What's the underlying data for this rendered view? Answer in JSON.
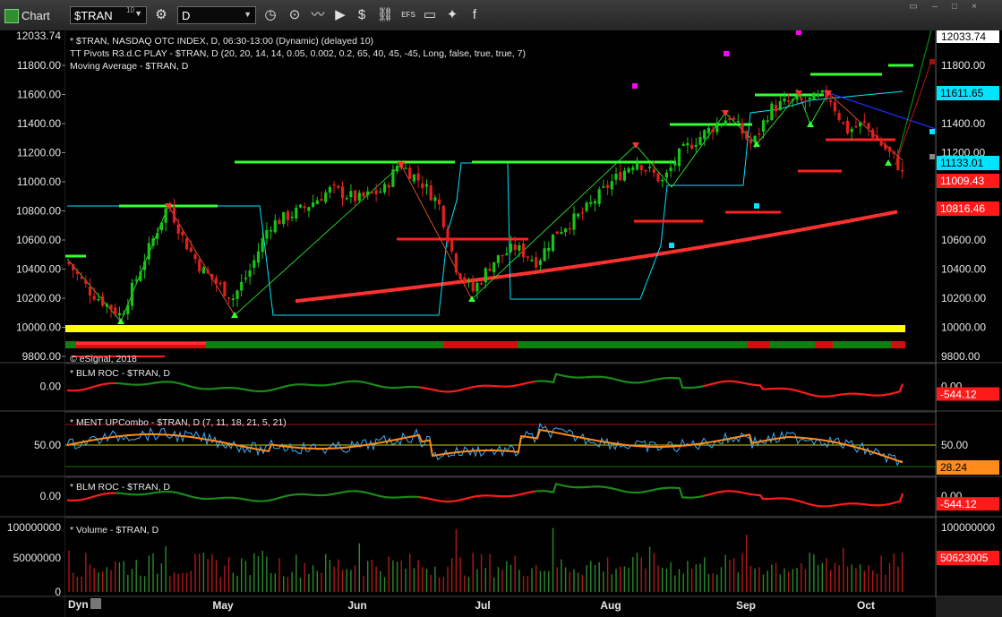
{
  "window": {
    "title": "Chart",
    "symbol": "$TRAN",
    "symbol_sup": "10",
    "interval": "D"
  },
  "toolbar_icons": [
    "settings-icon",
    "interval-clock-icon",
    "zoom-icon",
    "line-tool-icon",
    "play-icon",
    "dollar-icon",
    "link-icon",
    "efs-icon",
    "comment-icon",
    "twitter-icon",
    "facebook-icon"
  ],
  "price_panel": {
    "titles": [
      "* $TRAN, NASDAQ OTC INDEX, D, 06:30-13:00 (Dynamic) (delayed 10)",
      "TT Pivots R3.d.C PLAY - $TRAN, D (20, 20, 14, 14, 0.05, 0.002, 0.2, 65, 40, 45, -45, Long, false, true, true, 7)",
      "Moving Average - $TRAN, D"
    ],
    "watermark": "© eSignal, 2018",
    "y_ticks": [
      "11800.00",
      "11600.00",
      "11400.00",
      "11200.00",
      "11000.00",
      "10800.00",
      "10600.00",
      "10400.00",
      "10200.00",
      "10000.00",
      "9800.00"
    ],
    "top_value": "12033.74",
    "tags": [
      {
        "value": "11611.65",
        "bg": "#00e5ff",
        "fg": "#000000"
      },
      {
        "value": "11133.01",
        "bg": "#00e5ff",
        "fg": "#000000"
      },
      {
        "value": "11009.43",
        "bg": "#ff1a1a",
        "fg": "#ffffff"
      },
      {
        "value": "10816.46",
        "bg": "#ff1a1a",
        "fg": "#ffffff"
      }
    ]
  },
  "roc_panel_1": {
    "title": "* BLM ROC - $TRAN, D",
    "y_tick": "0.00",
    "tag": "-544.12"
  },
  "ment_panel": {
    "title": "* MENT UPCombo - $TRAN, D (7, 11, 18, 21, 5, 21)",
    "y_tick": "50.00",
    "tag": "28.24"
  },
  "roc_panel_2": {
    "title": "* BLM ROC - $TRAN, D",
    "y_tick": "0.00",
    "tag": "-544.12"
  },
  "volume_panel": {
    "title": "* Volume - $TRAN, D",
    "y_ticks": [
      "100000000",
      "50000000",
      "0"
    ],
    "tag": "50623005"
  },
  "x_axis": {
    "corner": "Dyn",
    "months": [
      "May",
      "Jun",
      "Jul",
      "Aug",
      "Sep",
      "Oct"
    ]
  },
  "colors": {
    "bull": "#19c419",
    "bear": "#e02020",
    "ma": "#ff3030",
    "pivot_green": "#33ff33",
    "pivot_red": "#ff2020",
    "cyan": "#00e5ff",
    "yellow": "#ffff00",
    "magenta": "#ff00ff"
  }
}
